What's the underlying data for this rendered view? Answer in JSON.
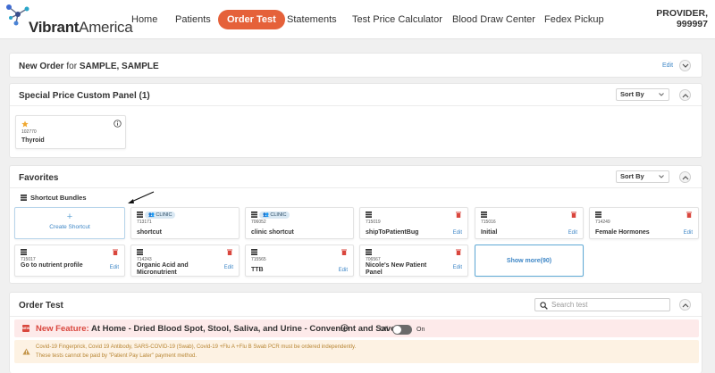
{
  "brand": {
    "name_bold": "Vibrant",
    "name_light": "America"
  },
  "nav": {
    "items": [
      "Home",
      "Patients",
      "Order Test",
      "Statements",
      "Test Price Calculator",
      "Blood Draw Center",
      "Fedex Pickup"
    ],
    "active": "Order Test",
    "active_color": "#e5613a"
  },
  "provider": {
    "line1": "PROVIDER,",
    "line2": "999997"
  },
  "new_order": {
    "prefix": "New Order",
    "for_word": "for",
    "patient": "SAMPLE, SAMPLE",
    "edit_label": "Edit"
  },
  "special_panel": {
    "title": "Special Price Custom Panel (1)",
    "sort_label": "Sort By",
    "card": {
      "code": "102770",
      "name": "Thyroid",
      "starred": true
    }
  },
  "favorites": {
    "title": "Favorites",
    "sort_label": "Sort By",
    "bundles_label": "Shortcut Bundles",
    "create_label": "Create Shortcut",
    "show_more_label": "Show more(90)",
    "cards": [
      {
        "code": "713171",
        "name": "shortcut",
        "badge": "CLINIC",
        "edit": ""
      },
      {
        "code": "706052",
        "name": "clinic shortcut",
        "badge": "CLINIC",
        "edit": ""
      },
      {
        "code": "715019",
        "name": "shipToPatientBug",
        "badge": "",
        "edit": "Edit"
      },
      {
        "code": "715016",
        "name": "Initial",
        "badge": "",
        "edit": "Edit"
      },
      {
        "code": "714249",
        "name": "Female Hormones",
        "badge": "",
        "edit": "Edit"
      },
      {
        "code": "715017",
        "name": "Go to nutrient profile",
        "badge": "",
        "edit": "Edit"
      },
      {
        "code": "714243",
        "name": "Organic Acid and Micronutrient",
        "badge": "",
        "edit": "Edit"
      },
      {
        "code": "715565",
        "name": "TTB",
        "badge": "",
        "edit": "Edit"
      },
      {
        "code": "706567",
        "name": "Nicole's New Patient Panel",
        "badge": "",
        "edit": "Edit"
      }
    ]
  },
  "order_test": {
    "title": "Order Test",
    "search_placeholder": "Search test",
    "feature": {
      "tag": "NEW",
      "prefix": "New Feature:",
      "text": "At Home - Dried Blood Spot, Stool, Saliva, and Urine - Convenient and Save!",
      "toggle_off": "Off",
      "toggle_on": "On"
    },
    "warning": {
      "line1": "Covid-19 Fingerprick, Covid 19 Antibody, SARS-COVID-19 (Swab), Covid-19 +Flu A +Flu B Swab PCR must be ordered independently.",
      "line2": "These tests cannot be paid by \"Patient Pay Later\" payment method."
    }
  }
}
